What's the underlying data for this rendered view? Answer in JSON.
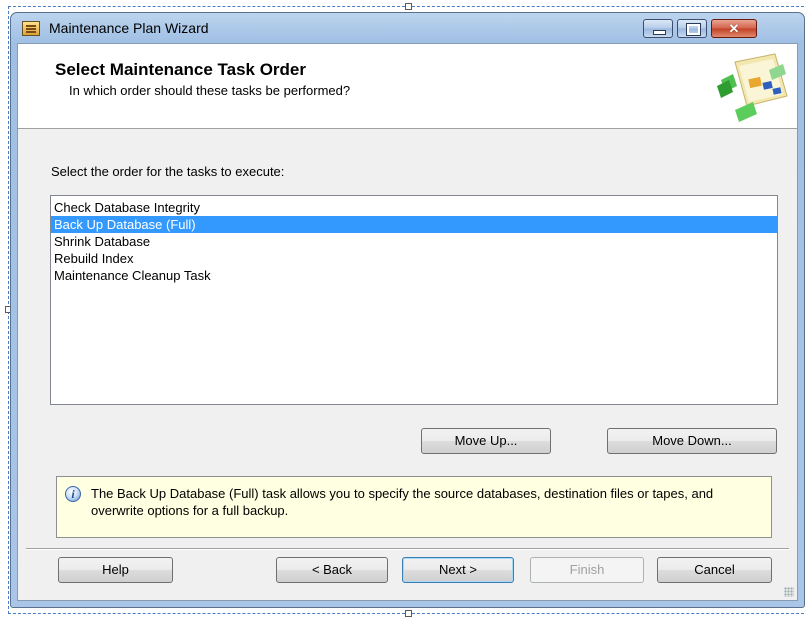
{
  "window": {
    "title": "Maintenance Plan Wizard",
    "controls": [
      "minimize",
      "maximize",
      "close"
    ]
  },
  "header": {
    "title": "Select Maintenance Task Order",
    "subtitle": "In which order should these tasks be performed?",
    "graphic_icon": "wizard-graphic-icon"
  },
  "main": {
    "instruction": "Select the order for the tasks to execute:",
    "tasks": [
      {
        "label": "Check Database Integrity",
        "selected": false
      },
      {
        "label": "Back Up Database (Full)",
        "selected": true
      },
      {
        "label": "Shrink Database",
        "selected": false
      },
      {
        "label": "Rebuild Index",
        "selected": false
      },
      {
        "label": "Maintenance Cleanup Task",
        "selected": false
      }
    ],
    "move_up_label": "Move Up...",
    "move_down_label": "Move Down...",
    "info_text": "The Back Up Database (Full) task allows you to specify the source databases, destination files or tapes, and overwrite options for a full backup."
  },
  "footer": {
    "help_label": "Help",
    "back_label": "< Back",
    "next_label": "Next >",
    "finish_label": "Finish",
    "cancel_label": "Cancel",
    "finish_disabled": true,
    "default_button": "next"
  },
  "colors": {
    "selection": "#3399ff",
    "info_background": "#ffffe1",
    "window_frame": "#a9c6e8"
  }
}
